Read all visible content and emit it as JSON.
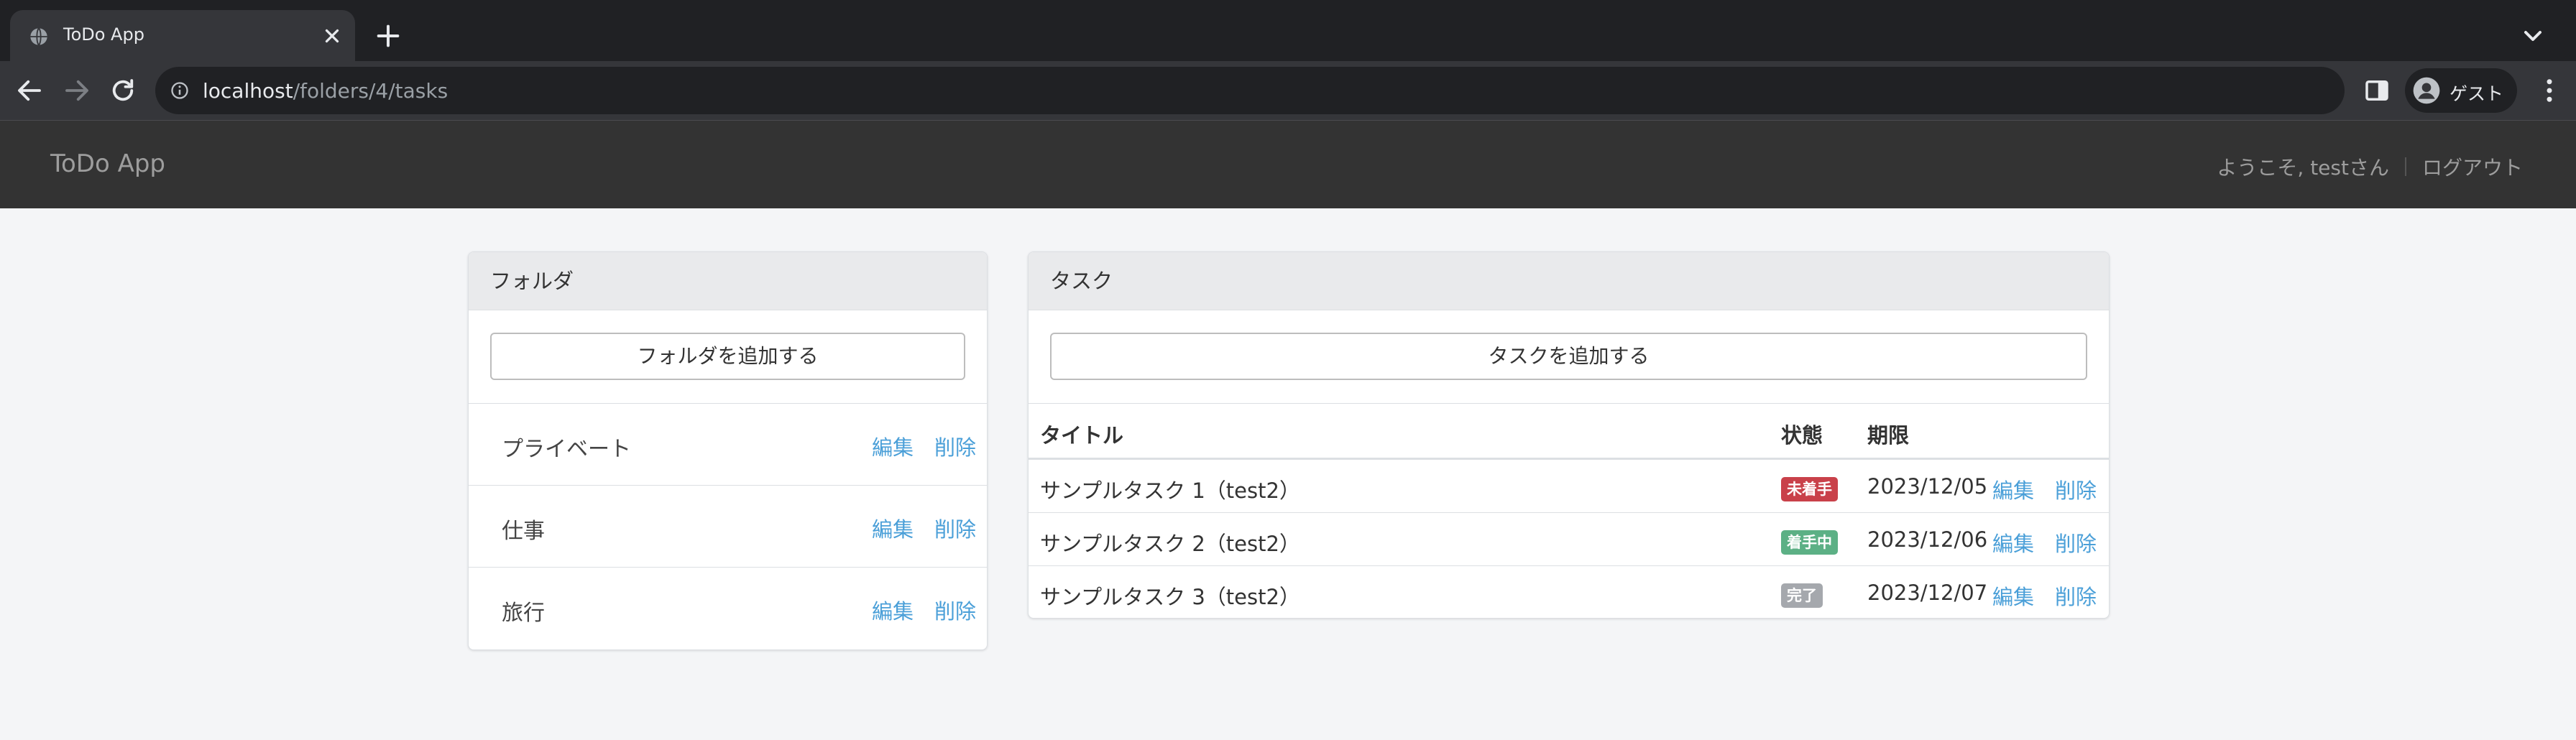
{
  "browser": {
    "tab_title": "ToDo App",
    "url_host": "localhost",
    "url_path": "/folders/4/tasks",
    "profile_name": "ゲスト"
  },
  "app": {
    "brand": "ToDo App",
    "welcome": "ようこそ, testさん",
    "logout": "ログアウト"
  },
  "folders": {
    "heading": "フォルダ",
    "add_label": "フォルダを追加する",
    "items": [
      {
        "name": "プライベート",
        "edit": "編集",
        "delete": "削除"
      },
      {
        "name": "仕事",
        "edit": "編集",
        "delete": "削除"
      },
      {
        "name": "旅行",
        "edit": "編集",
        "delete": "削除"
      }
    ]
  },
  "tasks": {
    "heading": "タスク",
    "add_label": "タスクを追加する",
    "columns": {
      "title": "タイトル",
      "status": "状態",
      "due": "期限"
    },
    "rows": [
      {
        "title": "サンプルタスク 1（test2）",
        "status": "未着手",
        "status_color": "#c9414a",
        "due": "2023/12/05",
        "edit": "編集",
        "delete": "削除"
      },
      {
        "title": "サンプルタスク 2（test2）",
        "status": "着手中",
        "status_color": "#5cb085",
        "due": "2023/12/06",
        "edit": "編集",
        "delete": "削除"
      },
      {
        "title": "サンプルタスク 3（test2）",
        "status": "完了",
        "status_color": "#a5a8ad",
        "due": "2023/12/07",
        "edit": "編集",
        "delete": "削除"
      }
    ]
  },
  "colors": {
    "link": "#4a9fd8",
    "navbar": "#333333",
    "page_bg": "#f4f5f7"
  }
}
